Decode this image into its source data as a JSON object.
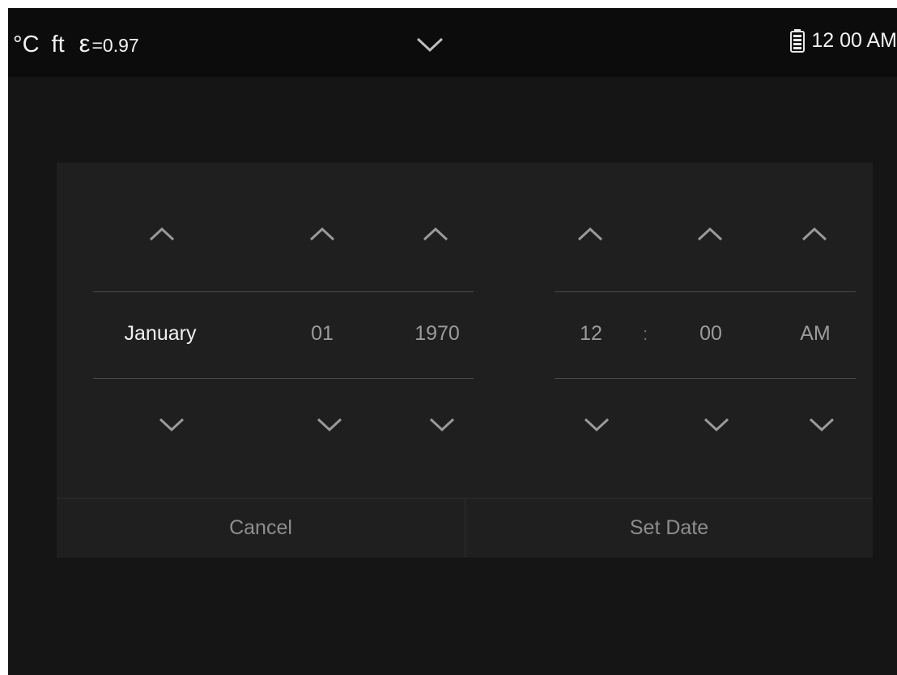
{
  "status_bar": {
    "temp_unit": "°C",
    "distance_unit": "ft",
    "emissivity_symbol": "ε",
    "emissivity_value": "=0.97",
    "expand_icon": "chevron-down-icon",
    "battery_icon": "battery-icon",
    "time": "12 00 AM"
  },
  "date_time_picker": {
    "date": {
      "month": "January",
      "day": "01",
      "year": "1970"
    },
    "time": {
      "hour": "12",
      "separator": ":",
      "minute": "00",
      "meridiem": "AM"
    },
    "up_icon": "chevron-up-icon",
    "down_icon": "chevron-down-icon"
  },
  "buttons": {
    "cancel": "Cancel",
    "set_date": "Set Date"
  },
  "colors": {
    "background": "#151515",
    "panel": "#1f1f1f",
    "status_bar": "#0c0c0c",
    "text_primary": "#f0f0f0",
    "text_secondary": "#9b9b9b",
    "arrow": "#9a9a9a"
  }
}
